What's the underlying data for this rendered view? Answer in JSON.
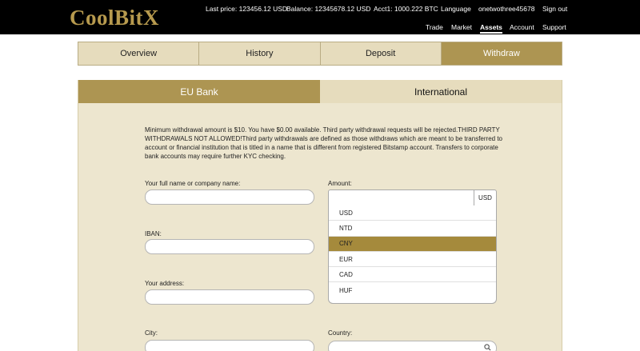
{
  "header": {
    "logo": "CoolBitX",
    "last_price": "Last price: 123456.12 USD",
    "balance": "Balance: 12345678.12 USD",
    "account_info": "Acct1: 1000.222 BTC",
    "language": "Language",
    "username": "onetwothree45678",
    "sign_out": "Sign out",
    "nav": [
      "Trade",
      "Market",
      "Assets",
      "Account",
      "Support"
    ],
    "active_nav": "Assets"
  },
  "main_tabs": [
    "Overview",
    "History",
    "Deposit",
    "Withdraw"
  ],
  "active_main_tab": "Withdraw",
  "sub_tabs": [
    "EU Bank",
    "International"
  ],
  "active_sub_tab": "EU Bank",
  "notice": "Minimum withdrawal amount is $10. You have $0.00 available. Third party withdrawal requests will be rejected.THIRD PARTY WITHDRAWALS NOT ALLOWED!Third party withdrawals are defined as those withdraws which are meant to be transferred to account or financial institution that is titled in a name that is different from registered Bitstamp account. Transfers to corporate bank accounts may require further KYC checking.",
  "form": {
    "full_name_label": "Your full name or company name:",
    "iban_label": "IBAN:",
    "address_label": "Your address:",
    "city_label": "City:",
    "amount_label": "Amount:",
    "currency_selected": "USD",
    "country_label": "Country:"
  },
  "currency_options": [
    "USD",
    "NTD",
    "CNY",
    "EUR",
    "CAD",
    "HUF"
  ],
  "highlighted_option": "CNY",
  "colors": {
    "gold": "#ad9552",
    "tab_bg": "#e6dcbd",
    "panel_bg": "#ede6cf",
    "header_bg": "#000000"
  }
}
